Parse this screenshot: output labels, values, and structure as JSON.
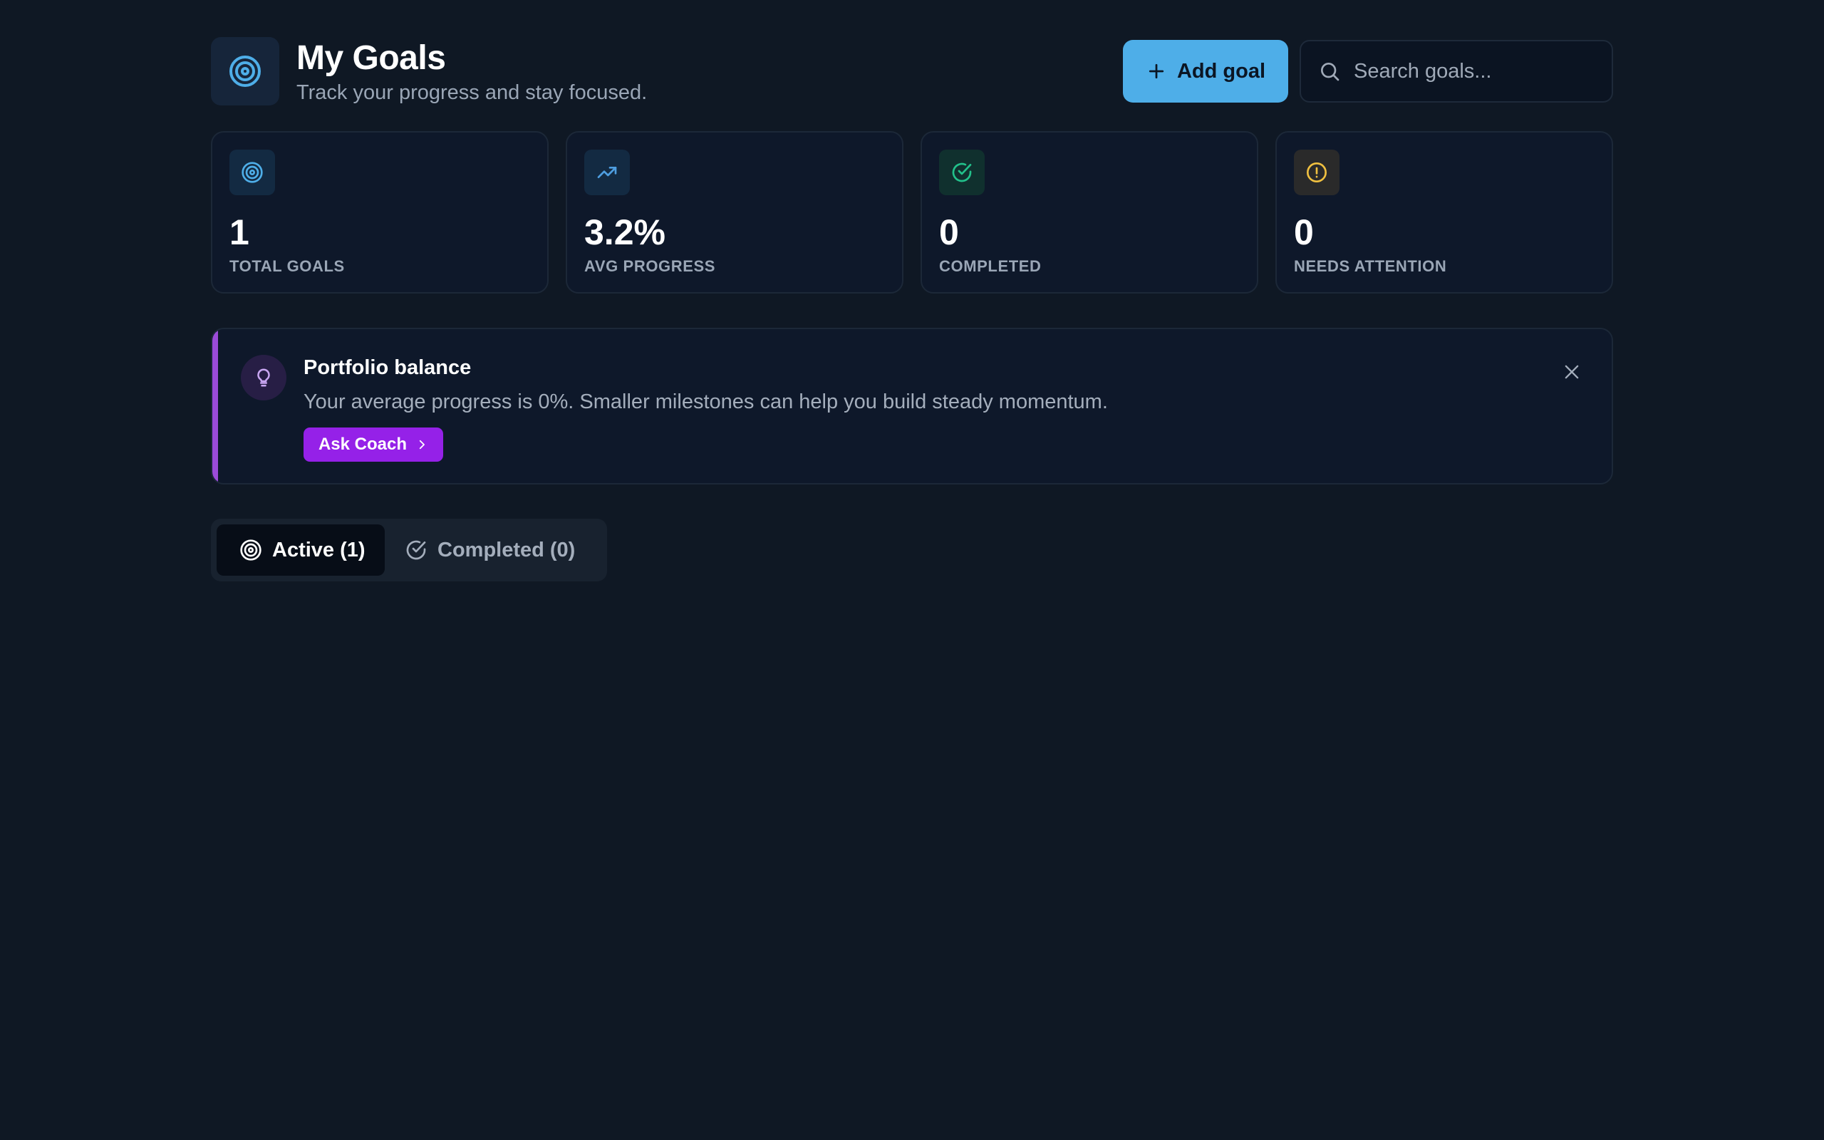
{
  "header": {
    "title": "My Goals",
    "subtitle": "Track your progress and stay focused.",
    "logo_icon": "target-icon",
    "add_button_label": "Add goal",
    "search_placeholder": "Search goals..."
  },
  "stats": [
    {
      "icon": "target-icon",
      "value": "1",
      "label": "TOTAL GOALS",
      "color": "#4eaee8"
    },
    {
      "icon": "trending-up-icon",
      "value": "3.2%",
      "label": "AVG PROGRESS",
      "color": "#4e9ee0"
    },
    {
      "icon": "check-circle-icon",
      "value": "0",
      "label": "COMPLETED",
      "color": "#22c08a"
    },
    {
      "icon": "alert-circle-icon",
      "value": "0",
      "label": "NEEDS ATTENTION",
      "color": "#f0c040"
    }
  ],
  "banner": {
    "icon": "lightbulb-icon",
    "title": "Portfolio balance",
    "text": "Your average progress is 0%. Smaller milestones can help you build steady momentum.",
    "button_label": "Ask Coach",
    "accent_color": "#9b4bd8"
  },
  "tabs": [
    {
      "label": "Active (1)",
      "icon": "target-icon",
      "active": true
    },
    {
      "label": "Completed (0)",
      "icon": "check-circle-icon",
      "active": false
    }
  ],
  "colors": {
    "background": "#0f1824",
    "primary": "#4eaee8",
    "coach": "#9521e8"
  }
}
